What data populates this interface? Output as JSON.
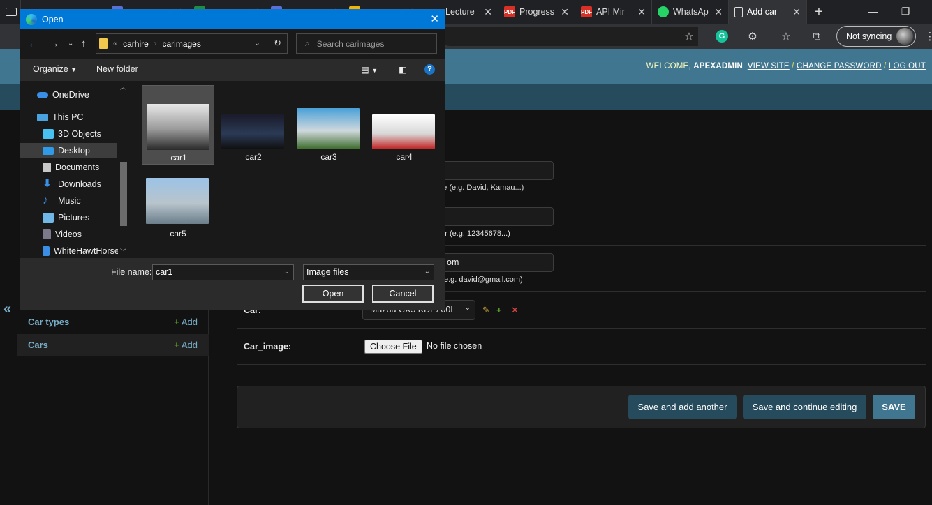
{
  "browser": {
    "tabs": [
      {
        "label": "",
        "icon": "folder-icon"
      },
      {
        "label": "",
        "icon": "doc-icon"
      },
      {
        "label": "",
        "icon": "sheet-icon"
      },
      {
        "label": "",
        "icon": "doc-icon"
      },
      {
        "label": "",
        "icon": "slides-icon"
      },
      {
        "label": "Lecture",
        "icon": "sheet-icon"
      },
      {
        "label": "Progress",
        "icon": "pdf-icon"
      },
      {
        "label": "API Mir",
        "icon": "pdf-icon"
      },
      {
        "label": "WhatsAp",
        "icon": "whatsapp-icon"
      },
      {
        "label": "Add car",
        "icon": "page-icon"
      }
    ],
    "pdf_badge": "PDF",
    "not_syncing": "Not syncing"
  },
  "admin": {
    "welcome_prefix": "WELCOME,",
    "username": "APEXADMIN",
    "view_site": "VIEW SITE",
    "change_password": "CHANGE PASSWORD",
    "log_out": "LOG OUT",
    "sep": "/",
    "sidebar": {
      "items": [
        {
          "label": "Car types",
          "add": "Add"
        },
        {
          "label": "Cars",
          "add": "Add"
        }
      ],
      "collapse": "«"
    },
    "form": {
      "name_value": "",
      "name_help": "me (e.g. David, Kamau...)",
      "phone_value": "",
      "phone_help": "ber (e.g. 12345678...)",
      "email_value": "om",
      "email_help": "e.g. david@gmail.com)",
      "car_label": "Car:",
      "car_value": "Mazda CX5 KDE200L",
      "car_image_label": "Car_image:",
      "choose_file": "Choose File",
      "no_file": "No file chosen"
    },
    "buttons": {
      "save_add_another": "Save and add another",
      "save_continue": "Save and continue editing",
      "save": "SAVE"
    }
  },
  "dialog": {
    "title": "Open",
    "path": {
      "root_chevron": "«",
      "segments": [
        "carhire",
        "carimages"
      ]
    },
    "search_placeholder": "Search carimages",
    "organize": "Organize",
    "new_folder": "New folder",
    "help": "?",
    "nav": [
      {
        "label": "OneDrive",
        "icon": "cloud-icon",
        "color": "#3a8ee6"
      },
      {
        "label": "This PC",
        "icon": "pc-icon",
        "color": "#4aa3df"
      },
      {
        "label": "3D Objects",
        "icon": "cube-icon",
        "color": "#48c0f0"
      },
      {
        "label": "Desktop",
        "icon": "desktop-icon",
        "color": "#2f9be8"
      },
      {
        "label": "Documents",
        "icon": "documents-icon",
        "color": "#c8c8c8"
      },
      {
        "label": "Downloads",
        "icon": "download-icon",
        "color": "#3a8ee6"
      },
      {
        "label": "Music",
        "icon": "music-icon",
        "color": "#3a8ee6"
      },
      {
        "label": "Pictures",
        "icon": "pictures-icon",
        "color": "#6fb8e8"
      },
      {
        "label": "Videos",
        "icon": "videos-icon",
        "color": "#7a7a8a"
      },
      {
        "label": "WhiteHawtHorse",
        "icon": "drive-icon",
        "color": "#3a8ee6"
      }
    ],
    "files": [
      {
        "name": "car1",
        "colors": [
          "#e8e8e8",
          "#9a9a9a",
          "#2a2a2a"
        ]
      },
      {
        "name": "car2",
        "colors": [
          "#1a1a2a",
          "#2b3a55",
          "#0f0f0f"
        ]
      },
      {
        "name": "car3",
        "colors": [
          "#4aa0d8",
          "#cfd8dc",
          "#3b6b2a"
        ]
      },
      {
        "name": "car4",
        "colors": [
          "#ffffff",
          "#d8d8d8",
          "#c21f1f"
        ]
      },
      {
        "name": "car5",
        "colors": [
          "#9cc3e6",
          "#b8c4cc",
          "#6a7e8a"
        ]
      }
    ],
    "file_name_label": "File name:",
    "file_name_value": "car1",
    "file_type": "Image files",
    "open": "Open",
    "cancel": "Cancel"
  }
}
